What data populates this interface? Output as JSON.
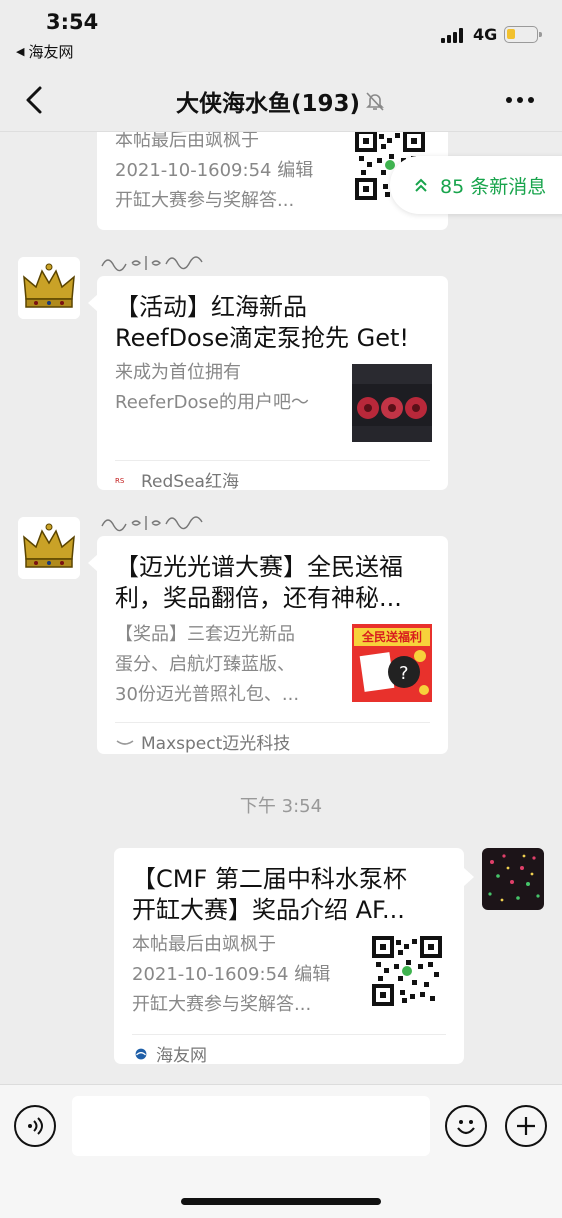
{
  "status_bar": {
    "time": "3:54",
    "back_app": "海友网",
    "network": "4G",
    "battery_level": 0.25
  },
  "nav": {
    "title": "大侠海水鱼(193)",
    "back_icon": "chevron-left-icon",
    "mute_icon": "bell-slash-icon",
    "more_icon": "more-dots-icon"
  },
  "new_messages": {
    "label": "85 条新消息"
  },
  "messages": [
    {
      "desc_lines": [
        "本帖最后由飒枫于",
        "2021-10-1609:54 编辑",
        "开缸大赛参与奖解答..."
      ]
    },
    {
      "title_lines": [
        "【活动】红海新品",
        "ReefDose滴定泵抢先 Get!"
      ],
      "desc_lines": [
        "来成为首位拥有",
        "ReeferDose的用户吧～"
      ],
      "source": "RedSea红海"
    },
    {
      "title_lines": [
        "【迈光光谱大赛】全民送福",
        "利，奖品翻倍，还有神秘..."
      ],
      "desc_lines": [
        "【奖品】三套迈光新品",
        "蛋分、启航灯臻蓝版、",
        "30份迈光普照礼包、..."
      ],
      "thumb_text": "全民送福利",
      "source": "Maxspect迈光科技"
    },
    {
      "title_lines": [
        "【CMF 第二届中科水泵杯",
        "开缸大赛】奖品介绍 AF..."
      ],
      "desc_lines": [
        "本帖最后由飒枫于",
        "2021-10-1609:54 编辑",
        "开缸大赛参与奖解答..."
      ],
      "source": "海友网"
    }
  ],
  "timestamp": "下午 3:54",
  "input_bar": {
    "voice_icon": "voice-icon",
    "emoji_icon": "emoji-icon",
    "plus_icon": "plus-icon"
  }
}
